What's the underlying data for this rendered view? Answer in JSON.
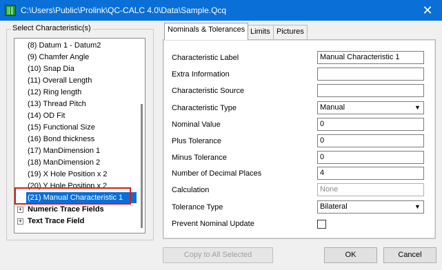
{
  "window": {
    "title": "C:\\Users\\Public\\Prolink\\QC-CALC 4.0\\Data\\Sample.Qcq",
    "close_symbol": "✕"
  },
  "left_panel": {
    "legend": "Select Characteristic(s)",
    "items": [
      "(8) Datum 1 - Datum2",
      "(9) Chamfer Angle",
      "(10) Snap Dia",
      "(11) Overall Length",
      "(12) Ring length",
      "(13) Thread Pitch",
      "(14) OD Fit",
      "(15) Functional Size",
      "(16) Bond thickness",
      "(17) ManDimension 1",
      "(18) ManDimension 2",
      "(19) X Hole Position x 2",
      "(20) Y Hole Position x 2",
      "(21) Manual Characteristic 1"
    ],
    "nodes": [
      {
        "expander": "+",
        "label": "Numeric Trace Fields"
      },
      {
        "expander": "+",
        "label": "Text Trace Field"
      }
    ]
  },
  "tabs": {
    "nominals": "Nominals & Tolerances",
    "limits": "Limits",
    "pictures": "Pictures"
  },
  "form": {
    "characteristic_label": {
      "label": "Characteristic Label",
      "value": "Manual Characteristic 1"
    },
    "extra_information": {
      "label": "Extra Information",
      "value": ""
    },
    "characteristic_source": {
      "label": "Characteristic Source",
      "value": ""
    },
    "characteristic_type": {
      "label": "Characteristic Type",
      "value": "Manual"
    },
    "nominal_value": {
      "label": "Nominal Value",
      "value": "0"
    },
    "plus_tolerance": {
      "label": "Plus Tolerance",
      "value": "0"
    },
    "minus_tolerance": {
      "label": "Minus Tolerance",
      "value": "0"
    },
    "decimal_places": {
      "label": "Number of Decimal Places",
      "value": "4"
    },
    "calculation": {
      "label": "Calculation",
      "value": "None"
    },
    "tolerance_type": {
      "label": "Tolerance Type",
      "value": "Bilateral"
    },
    "prevent_nominal_update": {
      "label": "Prevent Nominal Update",
      "checked": false
    }
  },
  "buttons": {
    "copy_all": "Copy to All Selected",
    "ok": "OK",
    "cancel": "Cancel"
  }
}
